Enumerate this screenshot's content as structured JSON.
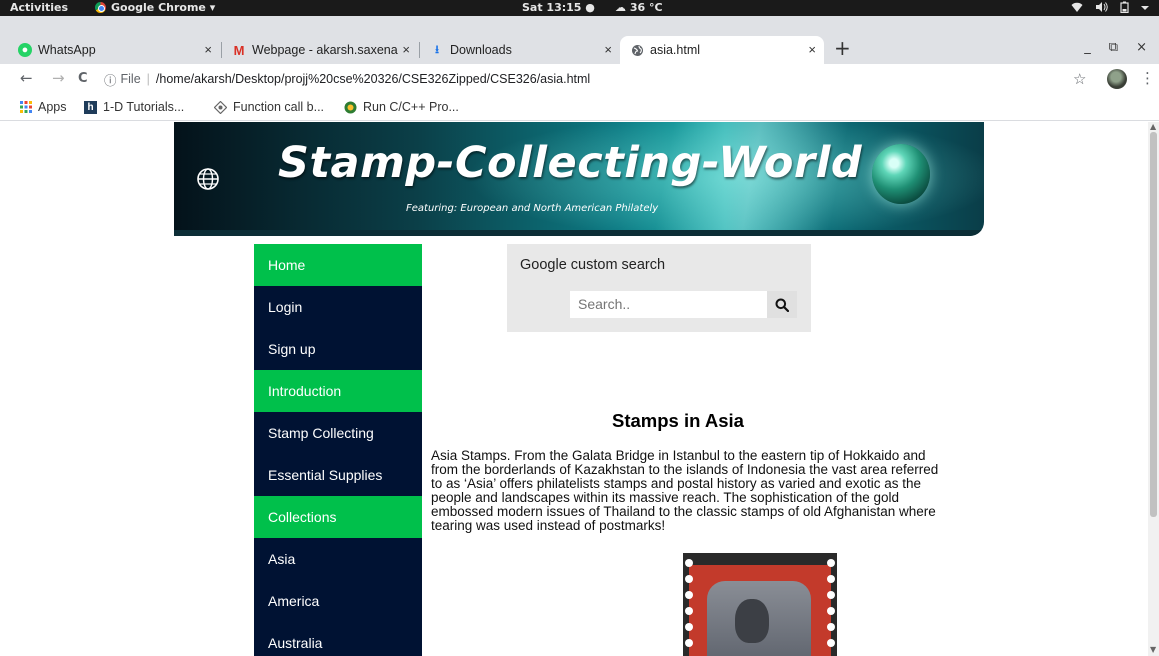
{
  "system_bar": {
    "activities": "Activities",
    "app_name": "Google Chrome ▾",
    "clock": "Sat 13:15 ●",
    "weather": "☁ 36 °C",
    "tray_icons": [
      "wifi-icon",
      "volume-icon",
      "battery-icon",
      "menu-caret-icon"
    ]
  },
  "tabs": [
    {
      "title": "WhatsApp",
      "favicon": "whatsapp-icon",
      "active": false
    },
    {
      "title": "Webpage - akarsh.saxena",
      "favicon": "gmail-icon",
      "active": false
    },
    {
      "title": "Downloads",
      "favicon": "download-icon",
      "active": false
    },
    {
      "title": "asia.html",
      "favicon": "globe-icon",
      "active": true
    }
  ],
  "tab_close": "×",
  "new_tab": "+",
  "window_controls": {
    "minimize": "_",
    "restore": "⧉",
    "close": "×"
  },
  "address": {
    "back": "←",
    "forward": "→",
    "reload": "C",
    "info": "ⓘ",
    "scheme": "File",
    "separator": "|",
    "url": "/home/akarsh/Desktop/projj%20cse%20326/CSE326Zipped/CSE326/asia.html",
    "star": "☆",
    "menu": "⋮"
  },
  "bookmarks": [
    {
      "label": "Apps",
      "icon": "apps-grid-icon"
    },
    {
      "label": "1-D Tutorials...",
      "icon": "tutorials-icon"
    },
    {
      "label": "Function call b...",
      "icon": "function-icon"
    },
    {
      "label": "Run C/C++ Pro...",
      "icon": "run-icon"
    }
  ],
  "banner": {
    "title": "Stamp-Collecting-World",
    "subtitle": "Featuring:  European and North American Philately"
  },
  "nav": [
    {
      "label": "Home",
      "highlight": true
    },
    {
      "label": "Login",
      "highlight": false
    },
    {
      "label": "Sign up",
      "highlight": false
    },
    {
      "label": "Introduction",
      "highlight": true
    },
    {
      "label": "Stamp Collecting",
      "highlight": false
    },
    {
      "label": "Essential Supplies",
      "highlight": false
    },
    {
      "label": "Collections",
      "highlight": true
    },
    {
      "label": "Asia",
      "highlight": false
    },
    {
      "label": "America",
      "highlight": false
    },
    {
      "label": "Australia",
      "highlight": false
    }
  ],
  "search": {
    "label": "Google custom search",
    "placeholder": "Search.."
  },
  "article": {
    "title": "Stamps in Asia",
    "body": "Asia Stamps. From the Galata Bridge in Istanbul to the eastern tip of Hokkaido and from the borderlands of Kazakhstan to the islands of Indonesia the vast area referred to as ‘Asia’ offers philatelists stamps and postal history as varied and exotic as the people and landscapes within its massive reach. The sophistication of the gold embossed modern issues of Thailand to the classic stamps of old Afghanistan where tearing was used instead of postmarks!"
  },
  "colors": {
    "nav_dark": "#001233",
    "nav_green": "#00c04b",
    "search_bg": "#e8e8e8"
  }
}
